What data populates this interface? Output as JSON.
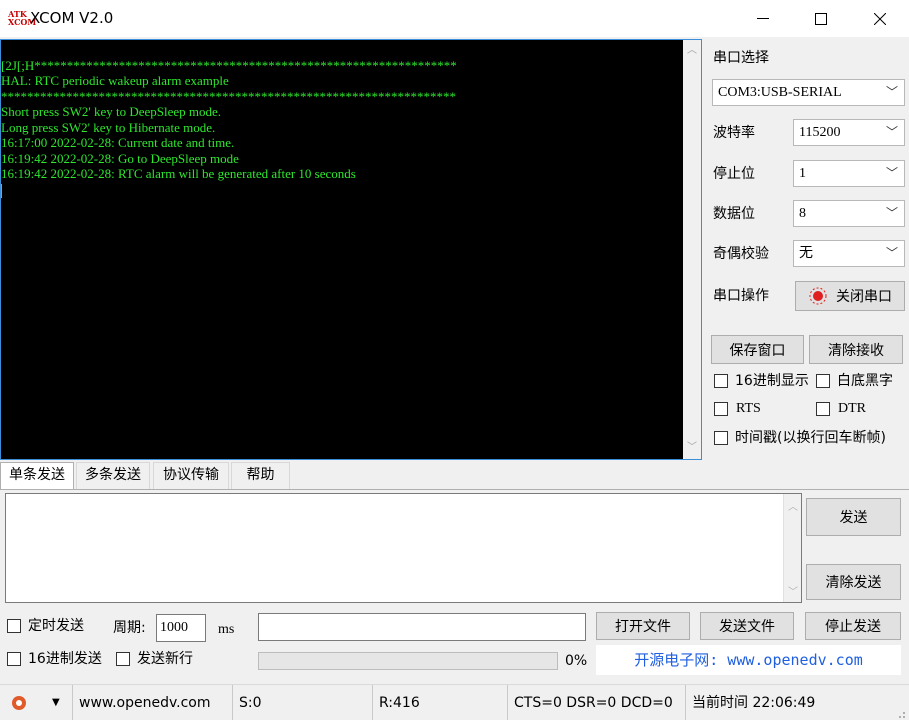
{
  "window": {
    "title": "XCOM V2.0",
    "logo_text": "ATK XCOM",
    "minimize": "—",
    "maximize": "☐",
    "close": "✕"
  },
  "terminal": {
    "lines": [
      "[2J[;H*****************************************************************",
      "HAL: RTC periodic wakeup alarm example",
      "**********************************************************************",
      "Short press SW2' key to DeepSleep mode.",
      "",
      "Long press SW2' key to Hibernate mode.",
      "",
      "16:17:00 2022-02-28: Current date and time.",
      "16:19:42 2022-02-28: Go to DeepSleep mode",
      "16:19:42 2022-02-28: RTC alarm will be generated after 10 seconds"
    ]
  },
  "settings": {
    "port_label": "串口选择",
    "port_value": "COM3:USB-SERIAL",
    "baud_label": "波特率",
    "baud_value": "115200",
    "stop_label": "停止位",
    "stop_value": "1",
    "data_label": "数据位",
    "data_value": "8",
    "parity_label": "奇偶校验",
    "parity_value": "无",
    "op_label": "串口操作",
    "op_button": "关闭串口"
  },
  "actions": {
    "save_window": "保存窗口",
    "clear_receive": "清除接收"
  },
  "options": {
    "hex_display": "16进制显示",
    "white_black": "白底黑字",
    "rts": "RTS",
    "dtr": "DTR",
    "timestamp": "时间戳(以换行回车断帧)"
  },
  "tabs": [
    "单条发送",
    "多条发送",
    "协议传输",
    "帮助"
  ],
  "send": {
    "send_button": "发送",
    "clear_send_button": "清除发送",
    "timed_send": "定时发送",
    "period_label": "周期:",
    "period_value": "1000",
    "period_unit": "ms",
    "hex_send": "16进制发送",
    "send_newline": "发送新行",
    "open_file": "打开文件",
    "send_file": "发送文件",
    "stop_send": "停止发送",
    "progress_text": "0%",
    "progress_value": 0,
    "url_banner": "开源电子网: www.openedv.com"
  },
  "status": {
    "menu_arrow": "▼",
    "website": "www.openedv.com",
    "sent": "S:0",
    "received": "R:416",
    "lines": "CTS=0 DSR=0 DCD=0",
    "time": "当前时间 22:06:49"
  },
  "colors": {
    "terminal_bg": "#000000",
    "terminal_text": "#2ee62e",
    "accent": "#3a8fd8",
    "url": "#1f5fe0",
    "indicator": "#e02020"
  }
}
